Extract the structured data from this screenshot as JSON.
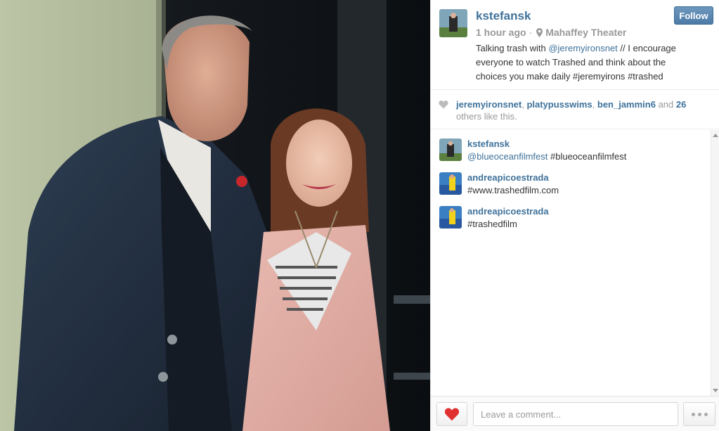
{
  "post": {
    "username": "kstefansk",
    "time": "1 hour ago",
    "separator": "·",
    "location": "Mahaffey Theater",
    "follow_label": "Follow",
    "caption": {
      "prefix": "Talking trash with ",
      "mention": "@jeremyironsnet",
      "middle": " // I encourage everyone to watch Trashed and think about the choices you make daily ",
      "tag1": "#jeremyirons",
      "space": " ",
      "tag2": "#trashed"
    }
  },
  "likes": {
    "users": [
      "jeremyironsnet",
      "platypusswims",
      "ben_jammin6"
    ],
    "sep": ", ",
    "and": " and ",
    "count": "26",
    "suffix": " others like this."
  },
  "comments": [
    {
      "user": "kstefansk",
      "mention": "@blueoceanfilmfest",
      "text": " #blueoceanfilmfest"
    },
    {
      "user": "andreapicoestrada",
      "mention": "",
      "text": "#www.trashedfilm.com"
    },
    {
      "user": "andreapicoestrada",
      "mention": "",
      "text": "#trashedfilm"
    }
  ],
  "footer": {
    "comment_placeholder": "Leave a comment..."
  },
  "icons": {
    "location": "location-pin-icon",
    "like_small": "heart-icon",
    "like_button": "heart-icon",
    "more": "more-options-icon"
  },
  "colors": {
    "link": "#3f729b",
    "follow_button": "#5582ad",
    "like_heart": "#e0302f",
    "muted": "#999999"
  }
}
